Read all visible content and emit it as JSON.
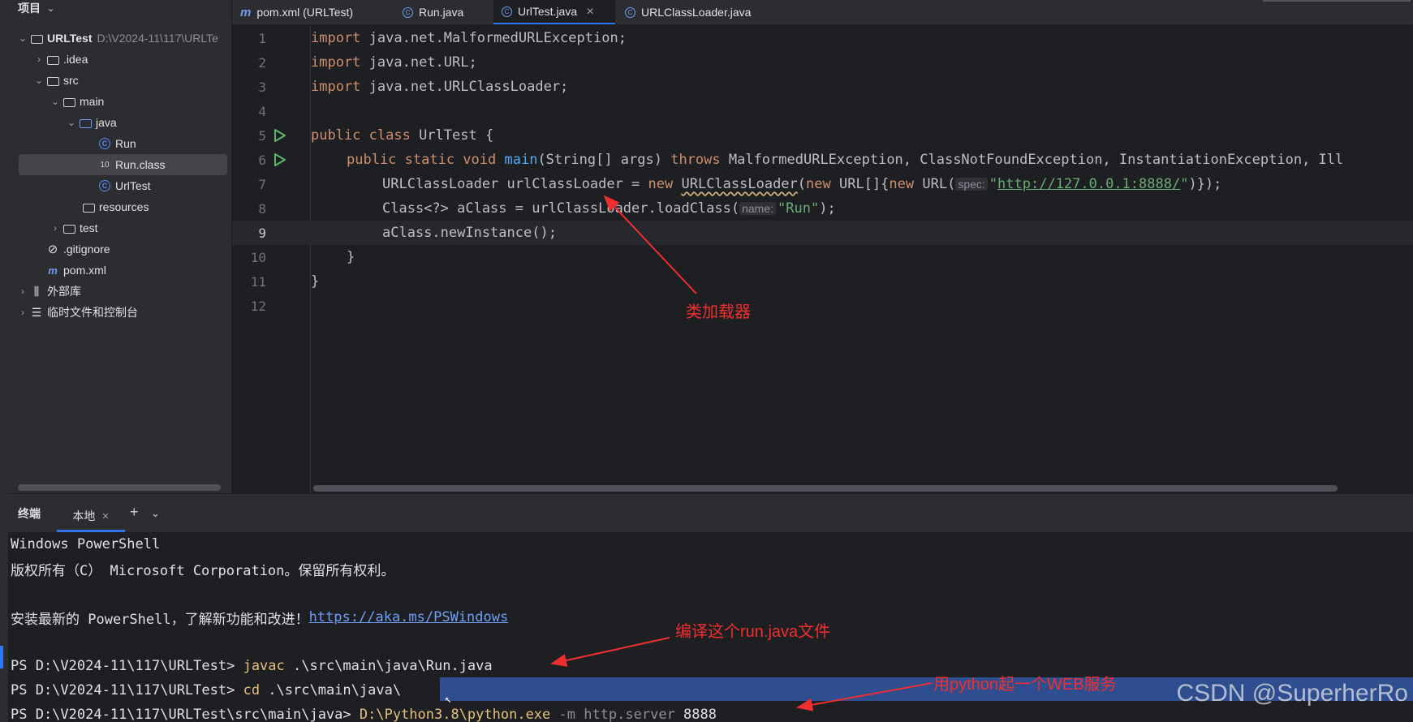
{
  "project": {
    "header": "项目",
    "root_name": "URLTest",
    "root_path": "D:\\V2024-11\\117\\URLTe",
    "items": [
      {
        "label": ".idea"
      },
      {
        "label": "src"
      },
      {
        "label": "main"
      },
      {
        "label": "java"
      },
      {
        "label": "Run"
      },
      {
        "label": "Run.class"
      },
      {
        "label": "UrlTest"
      },
      {
        "label": "resources"
      },
      {
        "label": "test"
      },
      {
        "label": ".gitignore"
      },
      {
        "label": "pom.xml"
      },
      {
        "label": "外部库"
      },
      {
        "label": "临时文件和控制台"
      }
    ]
  },
  "tabs": [
    {
      "label": "pom.xml (URLTest)"
    },
    {
      "label": "Run.java"
    },
    {
      "label": "UrlTest.java",
      "active": true
    },
    {
      "label": "URLClassLoader.java"
    }
  ],
  "editor": {
    "line_numbers": [
      "1",
      "2",
      "3",
      "4",
      "5",
      "6",
      "7",
      "8",
      "9",
      "10",
      "11",
      "12"
    ],
    "l1": [
      "import",
      " java.net.MalformedURLException;"
    ],
    "l2": [
      "import",
      " java.net.URL;"
    ],
    "l3": [
      "import",
      " java.net.URLClassLoader;"
    ],
    "l5": [
      "public class",
      " UrlTest {"
    ],
    "l6": [
      "public static void",
      "main",
      "(String[] args) ",
      "throws",
      " MalformedURLException, ClassNotFoundException, InstantiationException, Ill"
    ],
    "l7": [
      "URLClassLoader urlClassLoader = ",
      "new",
      "URLClassLoader",
      "(",
      "new",
      " URL[]{",
      "new",
      " URL(",
      "spec:",
      "\"",
      "http://127.0.0.1:8888/",
      "\"",
      ")});"
    ],
    "l8": [
      "Class<?> aClass = urlClassLoader.loadClass(",
      "name:",
      "\"Run\"",
      ");"
    ],
    "l9": "aClass.newInstance();",
    "l10": "}",
    "l11": "}"
  },
  "terminal": {
    "title": "终端",
    "tab_label": "本地",
    "lines": {
      "t1": "Windows PowerShell",
      "t2": "版权所有（C） Microsoft Corporation。保留所有权利。",
      "t4": "安装最新的 PowerShell，了解新功能和改进！",
      "t4_link": "https://aka.ms/PSWindows",
      "t6_prompt": "PS D:\\V2024-11\\117\\URLTest> ",
      "t6_cmd": "javac",
      "t6_rest": " .\\src\\main\\java\\Run.java",
      "t7_prompt": "PS D:\\V2024-11\\117\\URLTest> ",
      "t7_cmd": "cd",
      "t7_rest": " .\\src\\main\\java\\",
      "t8_prompt": "PS D:\\V2024-11\\117\\URLTest\\src\\main\\java> ",
      "t8_cmd": "D:\\Python3.8\\python.exe",
      "t8_arg": " -m http.server ",
      "t8_num": "8888"
    }
  },
  "annotations": {
    "a1": "类加载器",
    "a2": "编译这个run.java文件",
    "a3": "用python起一个WEB服务"
  },
  "watermark": "CSDN @SuperherRo",
  "colors": {
    "annotation": "#ef2f2f",
    "keyword": "#cf8e6d",
    "string": "#6aab73",
    "function": "#56a8f5",
    "accent": "#3574f0"
  }
}
